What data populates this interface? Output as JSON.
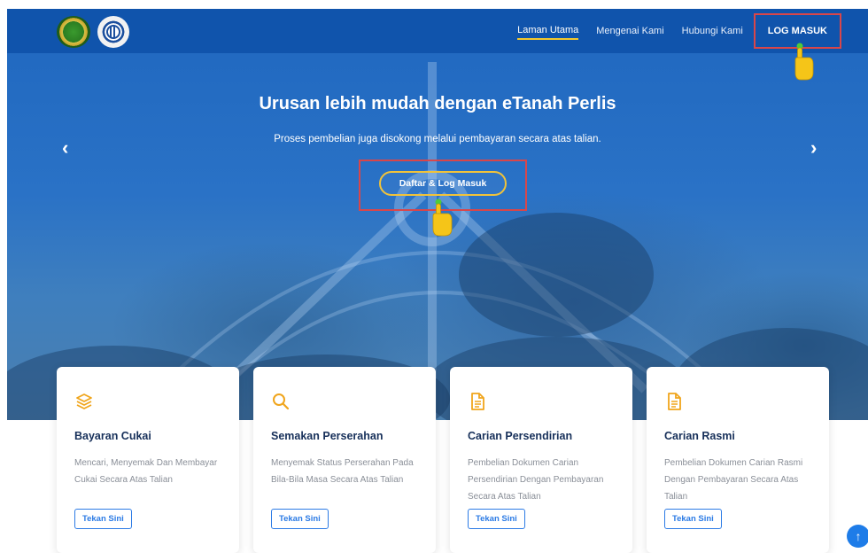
{
  "nav": {
    "links": [
      "Laman Utama",
      "Mengenai Kami",
      "Hubungi Kami"
    ],
    "login": "LOG MASUK"
  },
  "hero": {
    "title": "Urusan lebih mudah dengan eTanah Perlis",
    "subtitle": "Proses pembelian juga disokong melalui pembayaran secara atas talian.",
    "cta": "Daftar & Log Masuk",
    "prev": "‹",
    "next": "›"
  },
  "cards": [
    {
      "icon": "layers-icon",
      "title": "Bayaran Cukai",
      "desc": "Mencari, Menyemak Dan Membayar Cukai Secara Atas Talian",
      "button": "Tekan Sini"
    },
    {
      "icon": "search-icon",
      "title": "Semakan Perserahan",
      "desc": "Menyemak Status Perserahan Pada Bila-Bila Masa Secara Atas Talian",
      "button": "Tekan Sini"
    },
    {
      "icon": "document-icon",
      "title": "Carian Persendirian",
      "desc": "Pembelian Dokumen Carian Persendirian Dengan Pembayaran Secara Atas Talian",
      "button": "Tekan Sini"
    },
    {
      "icon": "document-icon",
      "title": "Carian Rasmi",
      "desc": "Pembelian Dokumen Carian Rasmi Dengan Pembayaran Secara Atas Talian",
      "button": "Tekan Sini"
    }
  ],
  "scroll_top": "↑",
  "colors": {
    "navbar": "#0f52aa",
    "accent_yellow": "#f4c82c",
    "highlight_red": "#d9464a",
    "card_title": "#17305a",
    "button_blue": "#2c7be5",
    "icon_orange": "#f0a51c"
  }
}
